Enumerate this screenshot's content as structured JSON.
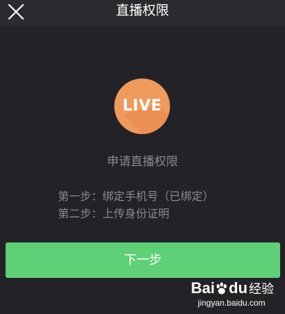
{
  "header": {
    "close_icon": "close-icon",
    "title": "直播权限"
  },
  "logo": {
    "text": "LIVE",
    "color": "#f09a5d"
  },
  "main": {
    "apply_title": "申请直播权限",
    "step1": "第一步：绑定手机号（已绑定）",
    "step2": "第二步：上传身份证明"
  },
  "next_button": {
    "label": "下一步",
    "color": "#5fcf78"
  },
  "watermark": {
    "brand_latin": "Bai",
    "brand_latin_tail": "du",
    "brand_cn": "经验",
    "url": "jingyan.baidu.com"
  }
}
